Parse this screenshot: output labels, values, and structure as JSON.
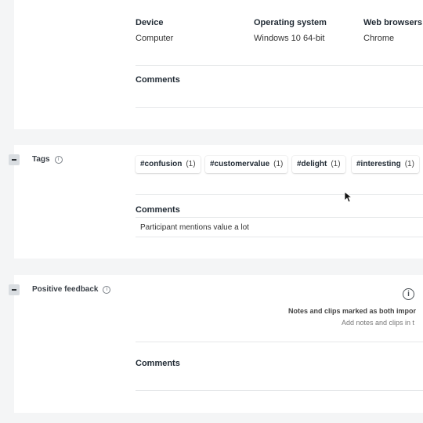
{
  "device_section": {
    "headers": {
      "device": "Device",
      "os": "Operating system",
      "browsers": "Web browsers"
    },
    "values": {
      "device": "Computer",
      "os": "Windows 10 64-bit",
      "browsers": "Chrome"
    },
    "comments_label": "Comments"
  },
  "tags_section": {
    "title": "Tags",
    "tags": [
      {
        "name": "#confusion",
        "count": "(1)"
      },
      {
        "name": "#customervalue",
        "count": "(1)"
      },
      {
        "name": "#delight",
        "count": "(1)"
      },
      {
        "name": "#interesting",
        "count": "(1)"
      }
    ],
    "comments_label": "Comments",
    "comment_text": "Participant mentions value a lot"
  },
  "positive_section": {
    "title": "Positive feedback",
    "empty_title": "Notes and clips marked as both impor",
    "empty_sub": "Add notes and clips in t",
    "comments_label": "Comments"
  },
  "icons": {
    "info": "info-icon",
    "collapse": "minus-icon",
    "cursor": "mouse-pointer-icon"
  },
  "colors": {
    "page_bg": "#f4f5f6",
    "card_bg": "#ffffff",
    "collapse_bg": "#d9dde1"
  }
}
